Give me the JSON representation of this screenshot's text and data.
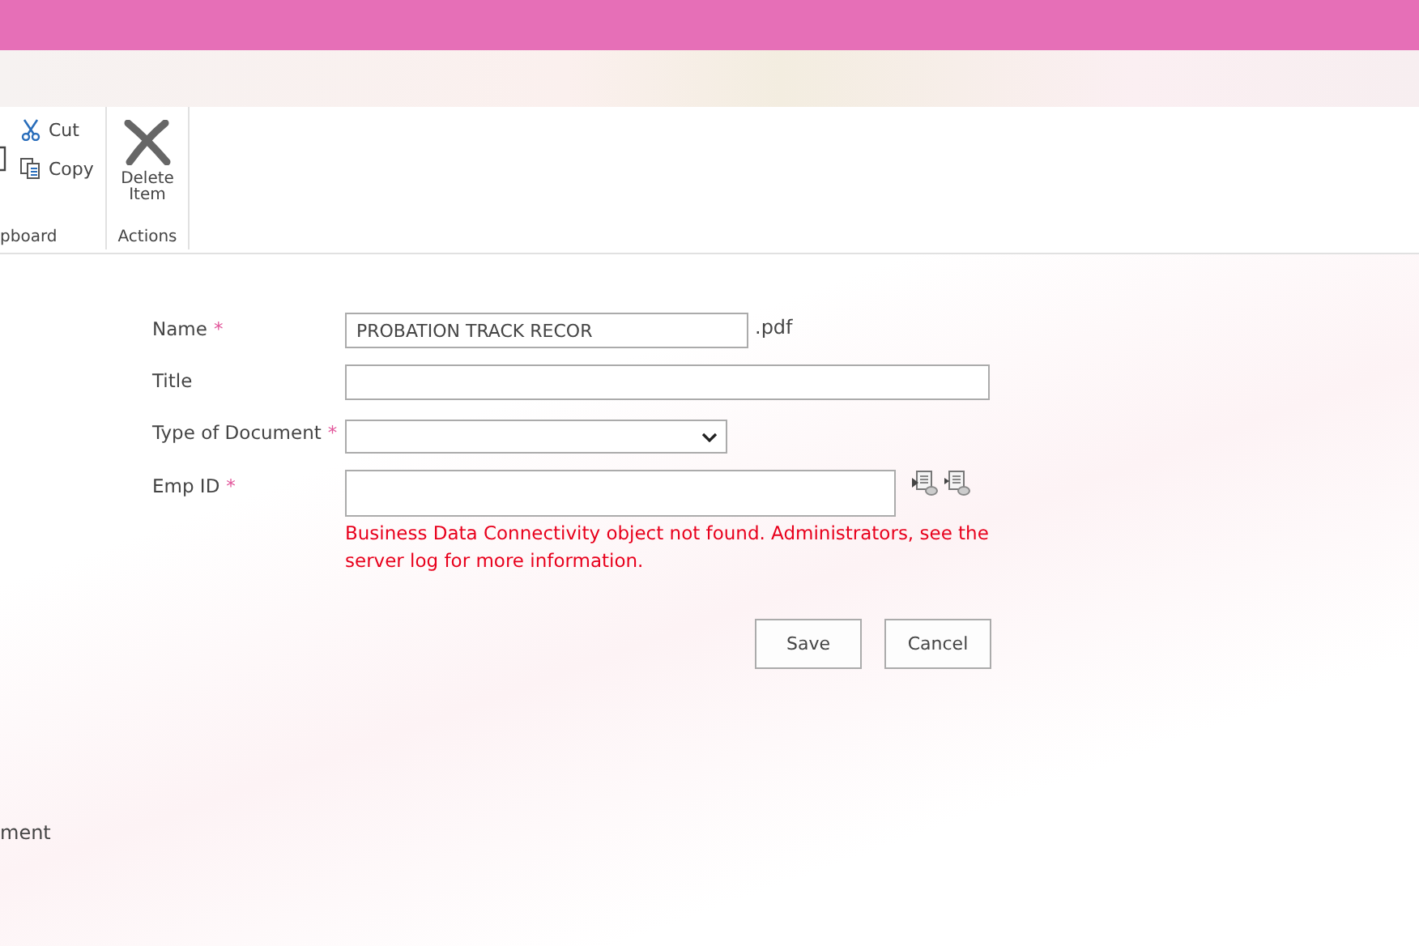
{
  "ribbon": {
    "groups": [
      {
        "kind": "clipboard",
        "label": "pboard",
        "items": [
          {
            "kind": "cut",
            "label": "Cut"
          },
          {
            "kind": "copy",
            "label": "Copy"
          }
        ]
      },
      {
        "kind": "actions",
        "label": "Actions",
        "items": [
          {
            "kind": "delete",
            "label": "Delete Item"
          }
        ]
      }
    ]
  },
  "form": {
    "fields": [
      {
        "kind": "text",
        "label": "Name",
        "required_mark": "*",
        "value": "PROBATION TRACK RECOR",
        "suffix": ".pdf"
      },
      {
        "kind": "wide",
        "label": "Title"
      },
      {
        "kind": "select",
        "label": "Type of Document",
        "required_mark": "*"
      },
      {
        "kind": "lookup",
        "label": "Emp ID",
        "required_mark": "*",
        "error": "Business Data Connectivity object not found. Administrators, see the server log for more information."
      }
    ],
    "buttons": [
      "Save",
      "Cancel"
    ]
  },
  "footer_text": "ment"
}
